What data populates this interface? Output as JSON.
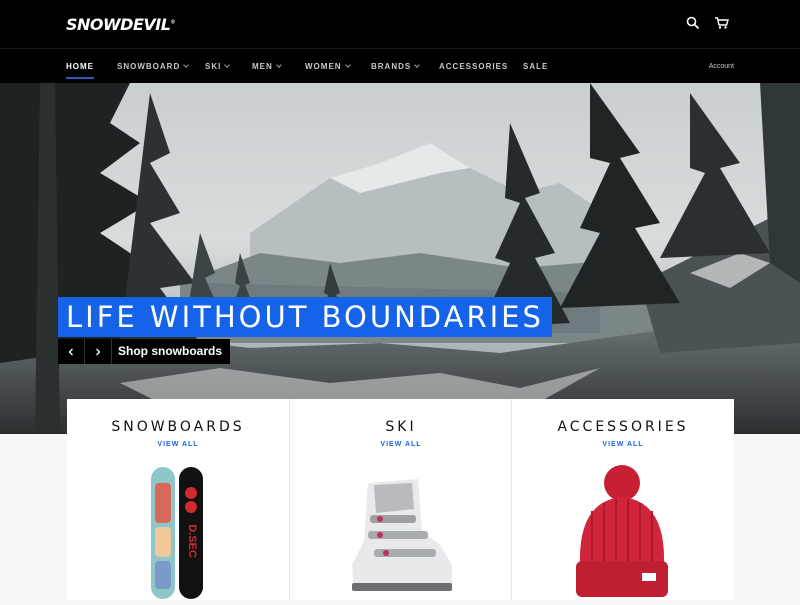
{
  "header": {
    "logo_text": "SNOWDEVIL",
    "logo_mark": "®",
    "icons": [
      "search-icon",
      "cart-icon"
    ]
  },
  "nav": {
    "items": [
      {
        "label": "Home",
        "active": true,
        "dropdown": false
      },
      {
        "label": "Snowboard",
        "active": false,
        "dropdown": true
      },
      {
        "label": "Ski",
        "active": false,
        "dropdown": true
      },
      {
        "label": "Men",
        "active": false,
        "dropdown": true
      },
      {
        "label": "Women",
        "active": false,
        "dropdown": true
      },
      {
        "label": "Brands",
        "active": false,
        "dropdown": true
      },
      {
        "label": "Accessories",
        "active": false,
        "dropdown": false
      },
      {
        "label": "Sale",
        "active": false,
        "dropdown": false
      }
    ],
    "account": "Account"
  },
  "hero": {
    "headline": "LIFE WITHOUT BOUNDARIES",
    "cta": "Shop snowboards",
    "prev_icon": "chevron-left-icon",
    "next_icon": "chevron-right-icon"
  },
  "categories": [
    {
      "title": "SNOWBOARDS",
      "link": "VIEW ALL"
    },
    {
      "title": "SKI",
      "link": "VIEW ALL"
    },
    {
      "title": "ACCESSORIES",
      "link": "VIEW ALL"
    }
  ],
  "colors": {
    "accent": "#1463e8",
    "header_bg": "#000000",
    "page_bg": "#f7f7f7"
  }
}
